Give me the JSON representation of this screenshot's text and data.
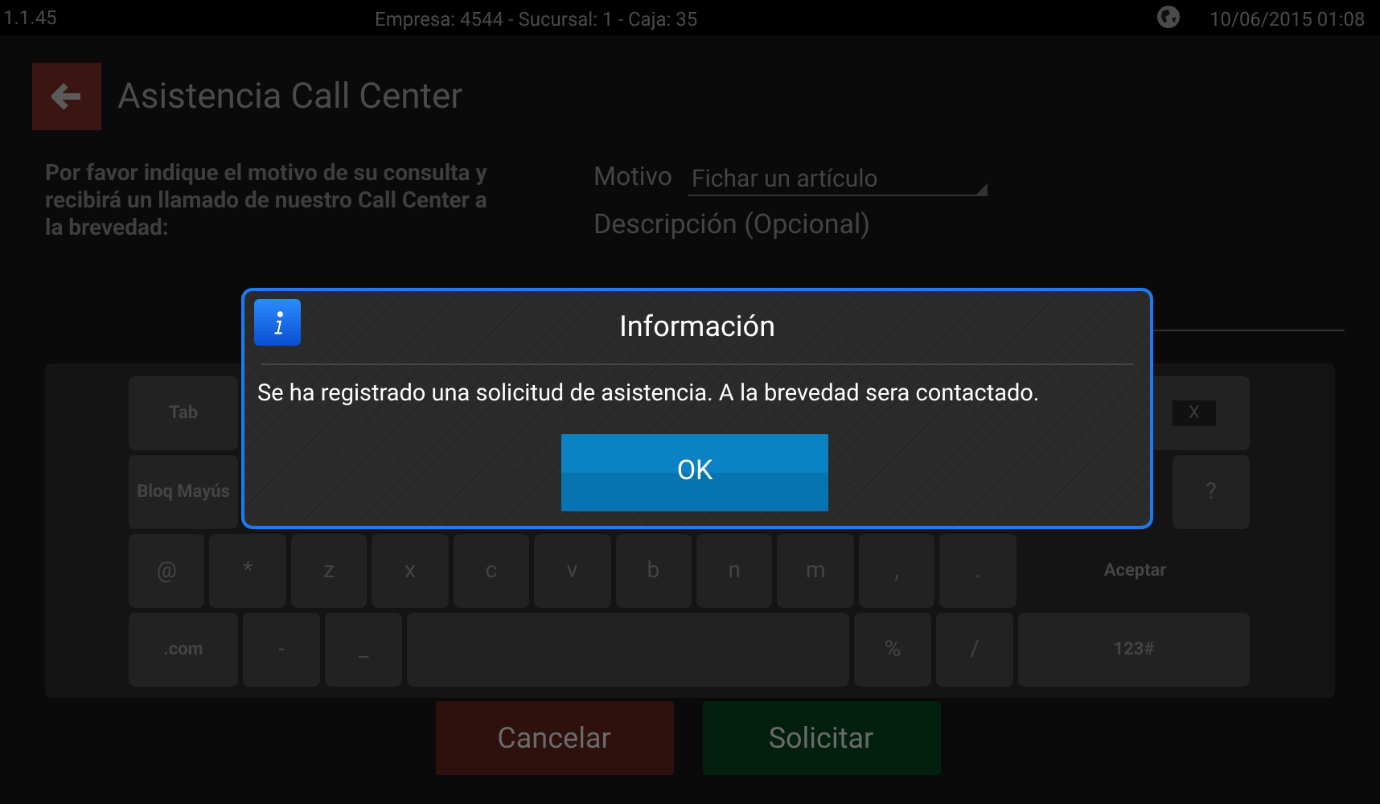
{
  "top_bar": {
    "version": "1.1.45",
    "company_info": "Empresa: 4544 - Sucursal: 1 - Caja: 35",
    "datetime": "10/06/2015 01:08"
  },
  "header": {
    "title": "Asistencia Call Center"
  },
  "form": {
    "instructions": "Por favor indique el motivo de su consulta y recibirá un llamado de nuestro Call Center a la brevedad:",
    "motivo": {
      "label": "Motivo",
      "value": "Fichar un artículo"
    },
    "description": {
      "placeholder": "Descripción (Opcional)"
    }
  },
  "keyboard": {
    "rows": [
      {
        "keys": [
          {
            "label": "Tab",
            "kind": "wide"
          },
          {
            "label": "X",
            "kind": "backspace"
          }
        ]
      },
      {
        "keys": [
          {
            "label": "Bloq Mayús",
            "kind": "wide"
          },
          {
            "label": "?",
            "kind": "char"
          }
        ]
      },
      {
        "keys": [
          {
            "label": "@",
            "kind": "char"
          },
          {
            "label": "*",
            "kind": "char"
          },
          {
            "label": "z",
            "kind": "char"
          },
          {
            "label": "x",
            "kind": "char"
          },
          {
            "label": "c",
            "kind": "char"
          },
          {
            "label": "v",
            "kind": "char"
          },
          {
            "label": "b",
            "kind": "char"
          },
          {
            "label": "n",
            "kind": "char"
          },
          {
            "label": "m",
            "kind": "char"
          },
          {
            "label": ",",
            "kind": "char"
          },
          {
            "label": ".",
            "kind": "char"
          },
          {
            "label": "Aceptar",
            "kind": "action"
          }
        ]
      },
      {
        "keys": [
          {
            "label": ".com",
            "kind": "wide"
          },
          {
            "label": "-",
            "kind": "char"
          },
          {
            "label": "_",
            "kind": "char"
          },
          {
            "kind": "space"
          },
          {
            "label": "%",
            "kind": "char"
          },
          {
            "label": "/",
            "kind": "char"
          },
          {
            "label": "123#",
            "kind": "action"
          }
        ]
      }
    ]
  },
  "buttons": [
    {
      "label": "Cancelar",
      "kind": "cancel"
    },
    {
      "label": "Solicitar",
      "kind": "confirm"
    }
  ],
  "dialog": {
    "title": "Información",
    "message": "Se ha registrado una solicitud de asistencia. A la brevedad sera contactado.",
    "button": "OK"
  }
}
